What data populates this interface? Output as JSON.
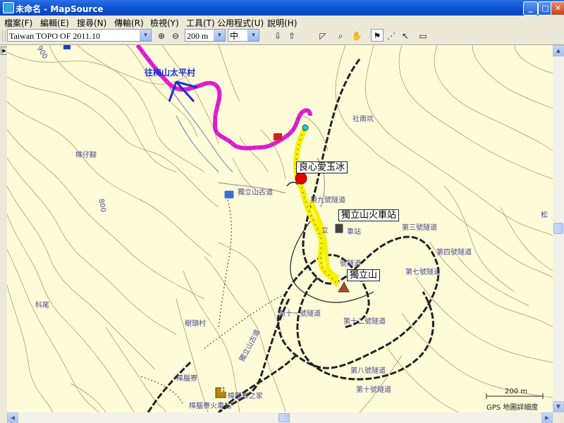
{
  "window": {
    "title": "未命名 - MapSource"
  },
  "menu": [
    "檔案(F)",
    "編輯(E)",
    "搜尋(N)",
    "傳輸(R)",
    "檢視(Y)",
    "工具(T)",
    "公用程式(U)",
    "說明(H)"
  ],
  "toolbar": {
    "map_product": "Taiwan TOPO OF 2011.10",
    "zoom_scale": "200 m",
    "detail_level": "中"
  },
  "map": {
    "callouts": {
      "blue_dest": "往梅山太平村",
      "waypoint1": "良心愛玉冰",
      "station": "獨立山火車站",
      "peak": "獨立山"
    },
    "labels": {
      "elev900": "900",
      "elev800": "800",
      "north_place": "社南坑",
      "west_place": "樟仔腳",
      "old_trail": "獨立山古道",
      "tunnel9": "第九號隧道",
      "station_small": "立",
      "station_small2": "車站",
      "tunnel3": "第三號隧道",
      "tunnel6": "第六號隧道",
      "tunnel4": "第四號隧道",
      "tunnel7": "第七號隧道",
      "tunnel5": "號隧道",
      "tunnel11": "第十一號隧道",
      "tunnel12": "第十二號隧道",
      "tunnel8": "第八號隧道",
      "tunnel10": "第十號隧道",
      "place_kewei": "科尾",
      "place_sugar": "樹頭村",
      "place_zhangnao": "樟腦寮",
      "place_zhangnao_home": "樟腦寮之家",
      "place_zhangnao_station": "樟腦寮火車站",
      "road_dulishan": "獨立山古道",
      "place_east": "松",
      "hotel_icon_letter": "H",
      "scale_text": "200 m",
      "detail_text": "GPS 地圖詳細度"
    }
  },
  "colors": {
    "track_magenta": "#e31ed3",
    "track_yellow": "#f5f000",
    "contour": "#b08a5a",
    "railway": "#222222",
    "waypoint_red": "#e00000",
    "arrow_blue": "#1a2fd8"
  }
}
